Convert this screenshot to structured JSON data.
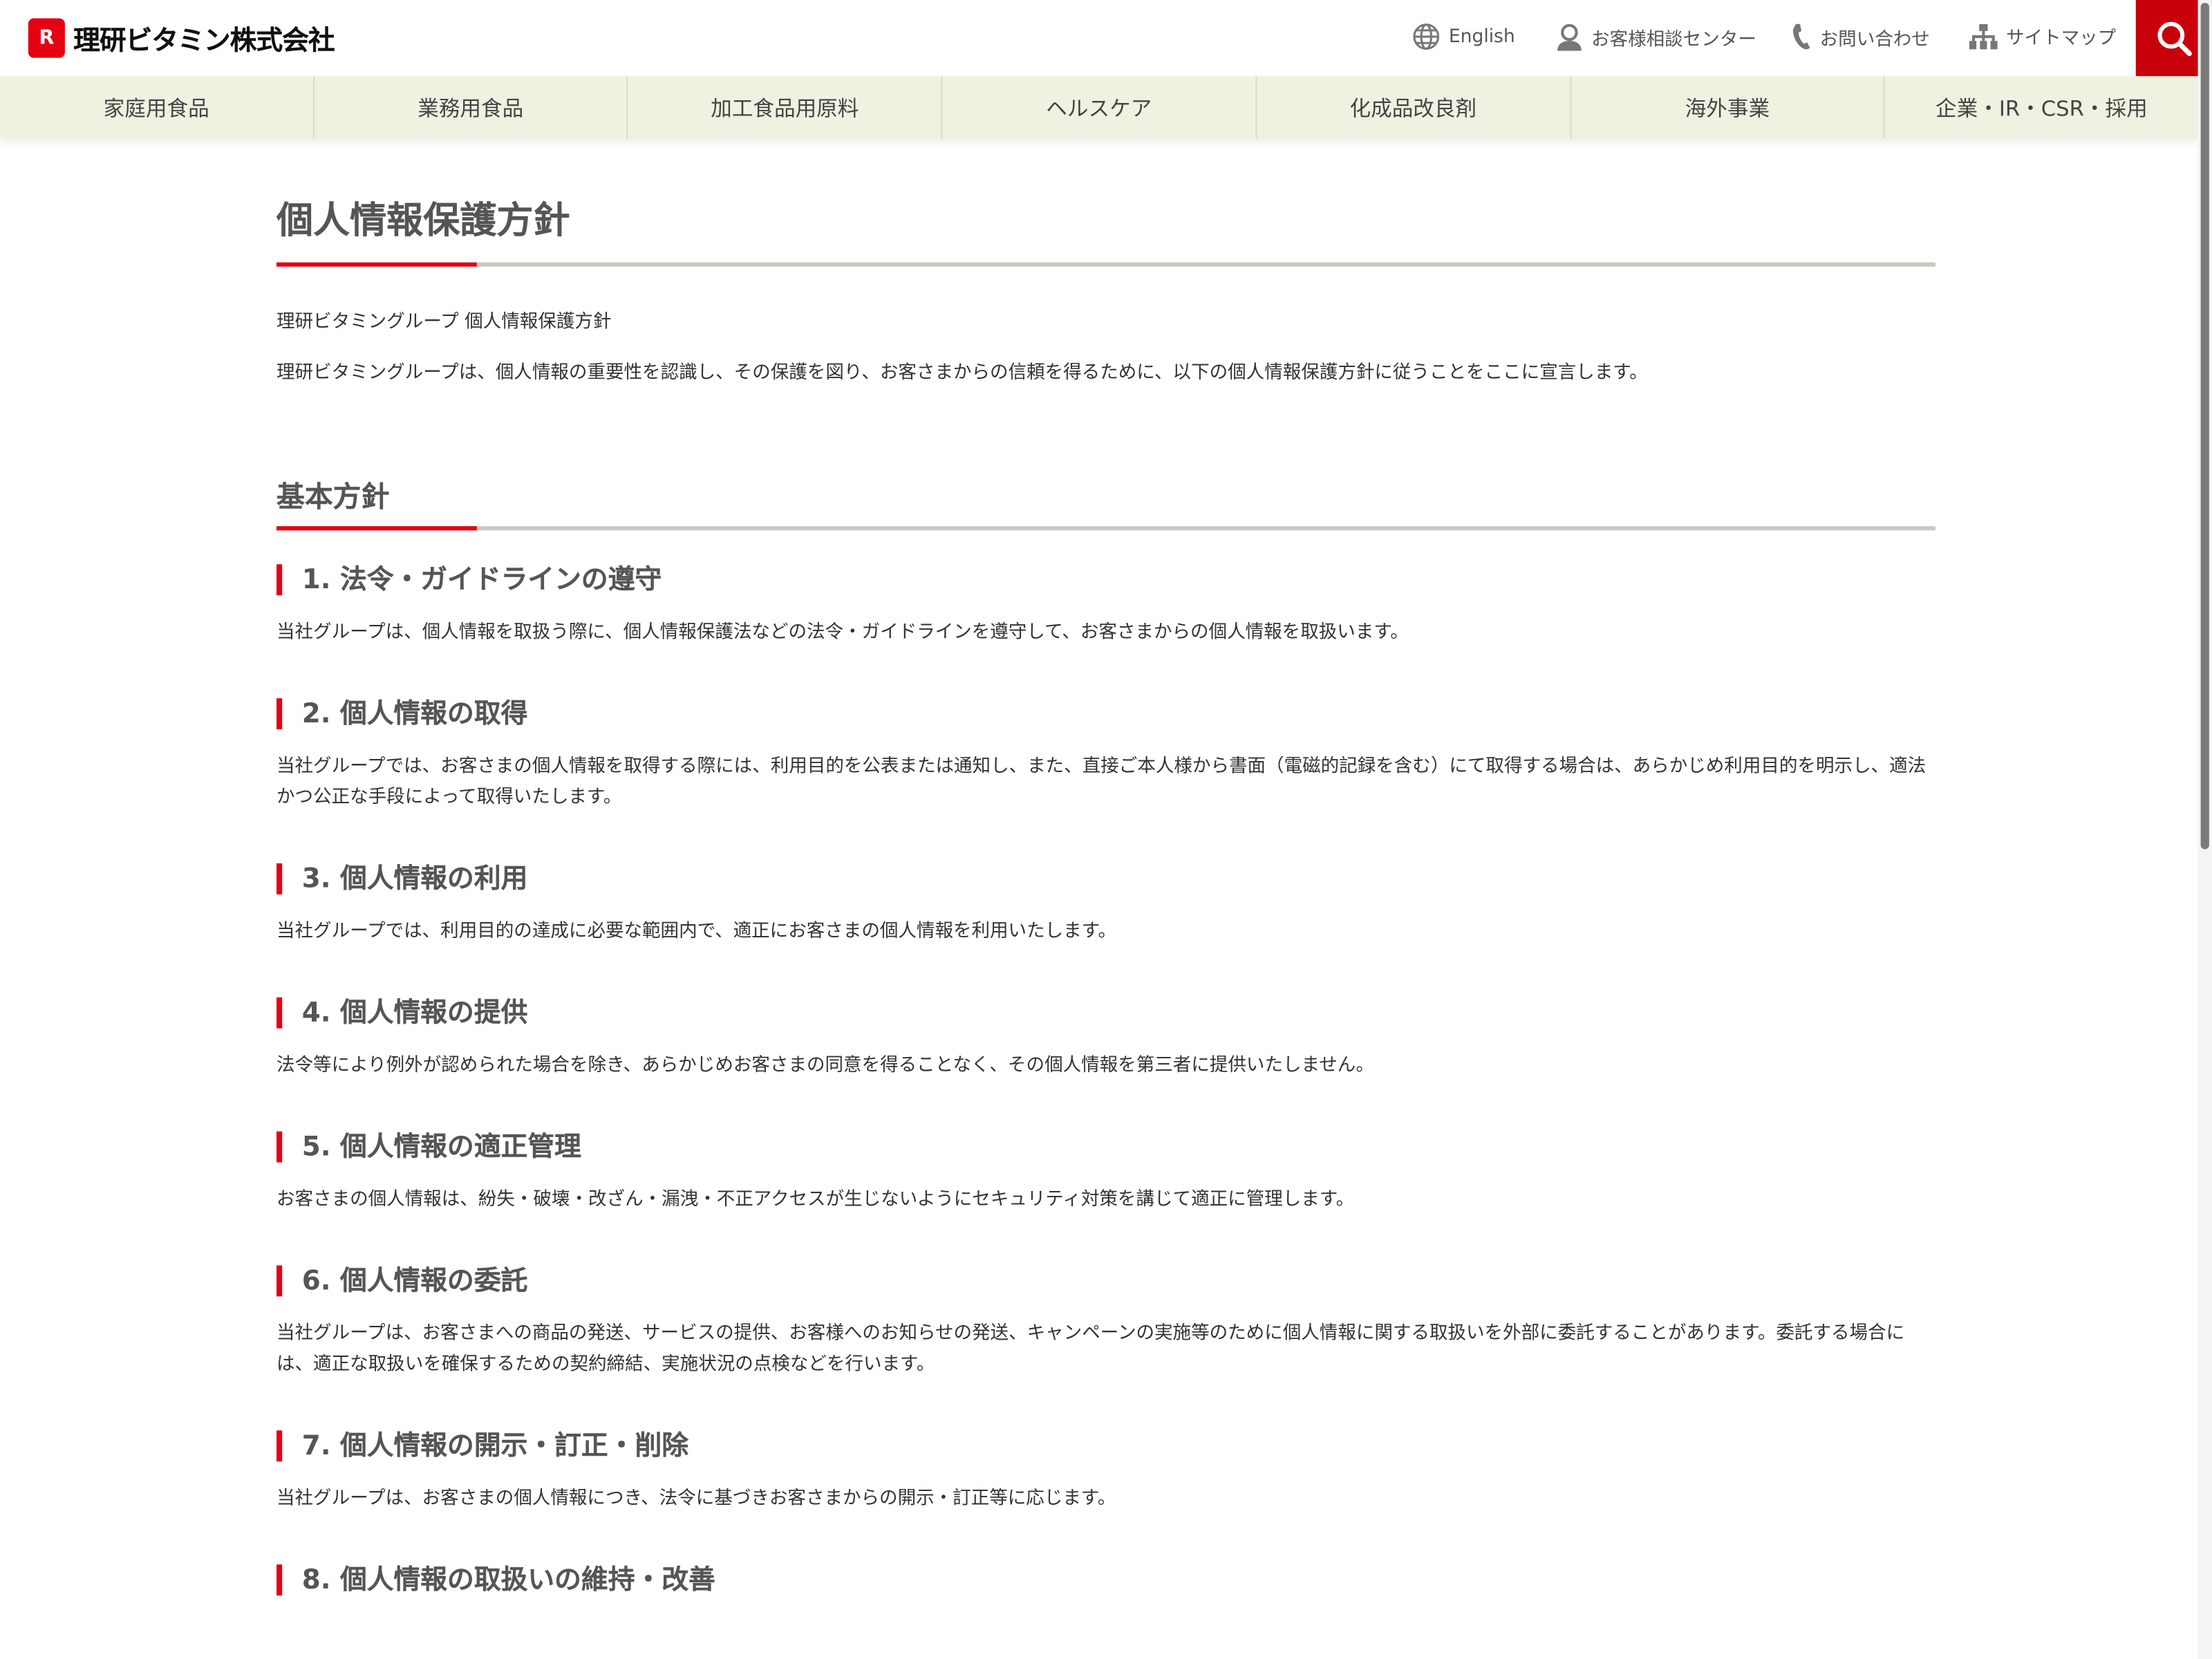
{
  "header": {
    "logo_mark": "R",
    "logo_text": "理研ビタミン株式会社",
    "utility": [
      {
        "label": "English",
        "icon": "globe-icon"
      },
      {
        "label": "お客様相談センター",
        "icon": "person-headset-icon"
      },
      {
        "label": "お問い合わせ",
        "icon": "phone-icon"
      },
      {
        "label": "サイトマップ",
        "icon": "sitemap-icon"
      }
    ],
    "search_icon": "search-icon",
    "accent": "#c8000a"
  },
  "nav": [
    "家庭用食品",
    "業務用食品",
    "加工食品用原料",
    "ヘルスケア",
    "化成品改良剤",
    "海外事業",
    "企業・IR・CSR・採用"
  ],
  "page": {
    "title": "個人情報保護方針",
    "subtitle": "理研ビタミングループ 個人情報保護方針",
    "intro": "理研ビタミングループは、個人情報の重要性を認識し、その保護を図り、お客さまからの信頼を得るために、以下の個人情報保護方針に従うことをここに宣言します。",
    "section_title": "基本方針",
    "items": [
      {
        "title": "1.  法令・ガイドラインの遵守",
        "text": "当社グループは、個人情報を取扱う際に、個人情報保護法などの法令・ガイドラインを遵守して、お客さまからの個人情報を取扱います。"
      },
      {
        "title": "2.  個人情報の取得",
        "text": "当社グループでは、お客さまの個人情報を取得する際には、利用目的を公表または通知し、また、直接ご本人様から書面（電磁的記録を含む）にて取得する場合は、あらかじめ利用目的を明示し、適法かつ公正な手段によって取得いたします。"
      },
      {
        "title": "3.  個人情報の利用",
        "text": "当社グループでは、利用目的の達成に必要な範囲内で、適正にお客さまの個人情報を利用いたします。"
      },
      {
        "title": "4.  個人情報の提供",
        "text": "法令等により例外が認められた場合を除き、あらかじめお客さまの同意を得ることなく、その個人情報を第三者に提供いたしません。"
      },
      {
        "title": "5.  個人情報の適正管理",
        "text": "お客さまの個人情報は、紛失・破壊・改ざん・漏洩・不正アクセスが生じないようにセキュリティ対策を講じて適正に管理します。"
      },
      {
        "title": "6.  個人情報の委託",
        "text": "当社グループは、お客さまへの商品の発送、サービスの提供、お客様へのお知らせの発送、キャンペーンの実施等のために個人情報に関する取扱いを外部に委託することがあります。委託する場合には、適正な取扱いを確保するための契約締結、実施状況の点検などを行います。"
      },
      {
        "title": "7.  個人情報の開示・訂正・削除",
        "text": "当社グループは、お客さまの個人情報につき、法令に基づきお客さまからの開示・訂正等に応じます。"
      },
      {
        "title": "8.  個人情報の取扱いの維持・改善",
        "text": ""
      }
    ]
  }
}
